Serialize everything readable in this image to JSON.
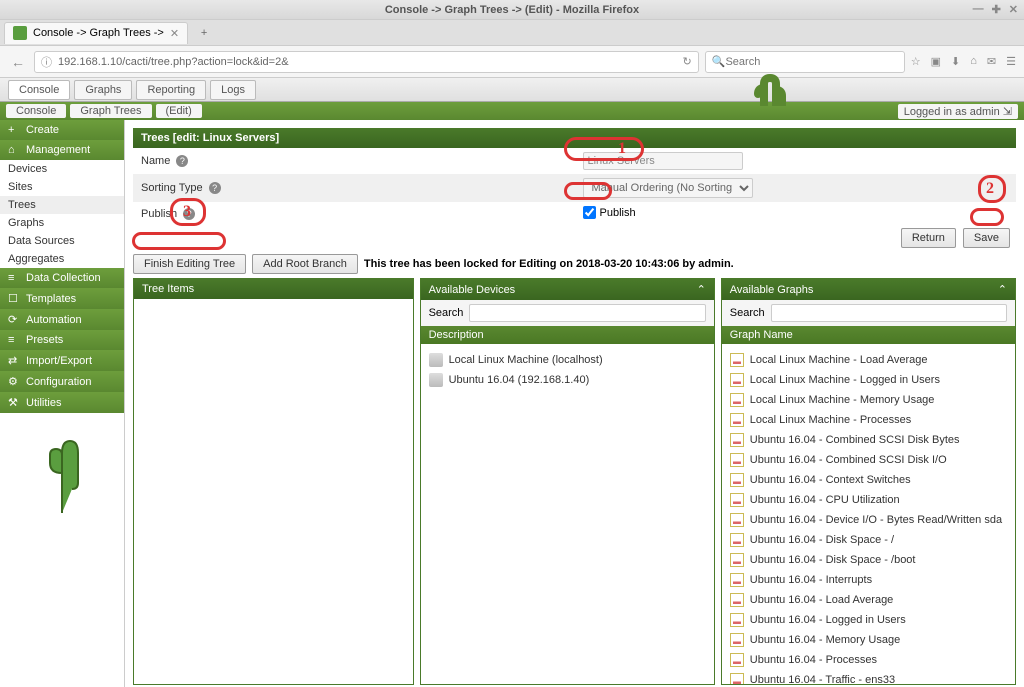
{
  "window": {
    "title": "Console -> Graph Trees -> (Edit) - Mozilla Firefox"
  },
  "browser": {
    "tab_title": "Console -> Graph Trees ->",
    "url": "192.168.1.10/cacti/tree.php?action=lock&id=2&",
    "search_placeholder": "Search"
  },
  "header_tabs": [
    "Console",
    "Graphs",
    "Reporting",
    "Logs"
  ],
  "breadcrumbs": [
    "Console",
    "Graph Trees",
    "(Edit)"
  ],
  "login_info": "Logged in as admin ",
  "sidebar": {
    "sections": [
      {
        "label": "Create",
        "icon": "+"
      },
      {
        "label": "Management",
        "icon": "⌂",
        "items": [
          "Devices",
          "Sites",
          "Trees",
          "Graphs",
          "Data Sources",
          "Aggregates"
        ]
      },
      {
        "label": "Data Collection",
        "icon": "≡"
      },
      {
        "label": "Templates",
        "icon": "☐"
      },
      {
        "label": "Automation",
        "icon": "⟳"
      },
      {
        "label": "Presets",
        "icon": "≡"
      },
      {
        "label": "Import/Export",
        "icon": "⇄"
      },
      {
        "label": "Configuration",
        "icon": "⚙"
      },
      {
        "label": "Utilities",
        "icon": "⚒"
      }
    ],
    "active_item": "Trees"
  },
  "panel": {
    "title": "Trees [edit: Linux Servers]",
    "fields": {
      "name_label": "Name",
      "name_value": "Linux Servers",
      "sorting_label": "Sorting Type",
      "sorting_value": "Manual Ordering (No Sorting)",
      "publish_label": "Publish",
      "publish_checkbox_label": "Publish",
      "publish_checked": true
    },
    "buttons": {
      "return": "Return",
      "save": "Save",
      "finish": "Finish Editing Tree",
      "add_root": "Add Root Branch"
    },
    "lock_message": "This tree has been locked for Editing on 2018-03-20 10:43:06 by admin."
  },
  "columns": {
    "tree_items": {
      "title": "Tree Items"
    },
    "devices": {
      "title": "Available Devices",
      "search_label": "Search",
      "subheader": "Description",
      "items": [
        "Local Linux Machine (localhost)",
        "Ubuntu 16.04 (192.168.1.40)"
      ]
    },
    "graphs": {
      "title": "Available Graphs",
      "search_label": "Search",
      "subheader": "Graph Name",
      "items": [
        "Local Linux Machine - Load Average",
        "Local Linux Machine - Logged in Users",
        "Local Linux Machine - Memory Usage",
        "Local Linux Machine - Processes",
        "Ubuntu 16.04 - Combined SCSI Disk Bytes",
        "Ubuntu 16.04 - Combined SCSI Disk I/O",
        "Ubuntu 16.04 - Context Switches",
        "Ubuntu 16.04 - CPU Utilization",
        "Ubuntu 16.04 - Device I/O - Bytes Read/Written sda",
        "Ubuntu 16.04 - Disk Space - /",
        "Ubuntu 16.04 - Disk Space - /boot",
        "Ubuntu 16.04 - Interrupts",
        "Ubuntu 16.04 - Load Average",
        "Ubuntu 16.04 - Logged in Users",
        "Ubuntu 16.04 - Memory Usage",
        "Ubuntu 16.04 - Processes",
        "Ubuntu 16.04 - Traffic - ens33"
      ]
    }
  },
  "annotations": {
    "1": "1",
    "2": "2",
    "3": "3"
  }
}
